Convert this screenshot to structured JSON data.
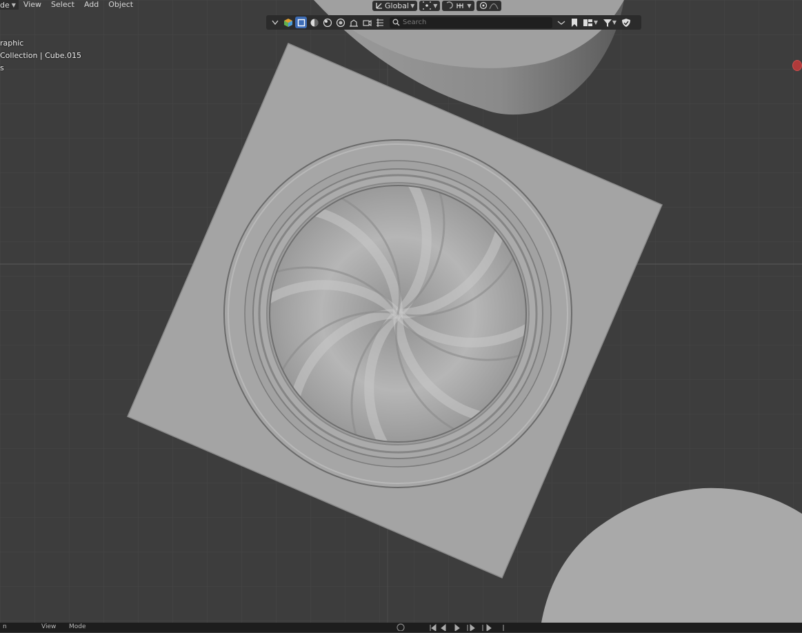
{
  "header": {
    "mode_label": "de",
    "menus": [
      "View",
      "Select",
      "Add",
      "Object"
    ],
    "orientation_label": "Global"
  },
  "outliner_filter": {
    "search_placeholder": "Search"
  },
  "viewport_overlay": {
    "line1": "raphic",
    "line2": "Collection | Cube.015",
    "line3": "s"
  },
  "footer": {
    "items": [
      "n",
      "View",
      "Mode"
    ]
  },
  "colors": {
    "viewport_bg": "#3d3d3d",
    "grid_line": "#4a4a4a",
    "mesh": "#a6a6a6",
    "header_bg": "#2d2d2d",
    "axis_x": "#b03a3a"
  },
  "icons": [
    "chevron-down-icon",
    "object-color-icon",
    "select-box-icon",
    "viewport-shading-icon",
    "toggle-icon",
    "snap-icon",
    "proportional-icon",
    "search-icon",
    "bookmark-icon",
    "collection-icon",
    "filter-icon",
    "shield-icon"
  ]
}
